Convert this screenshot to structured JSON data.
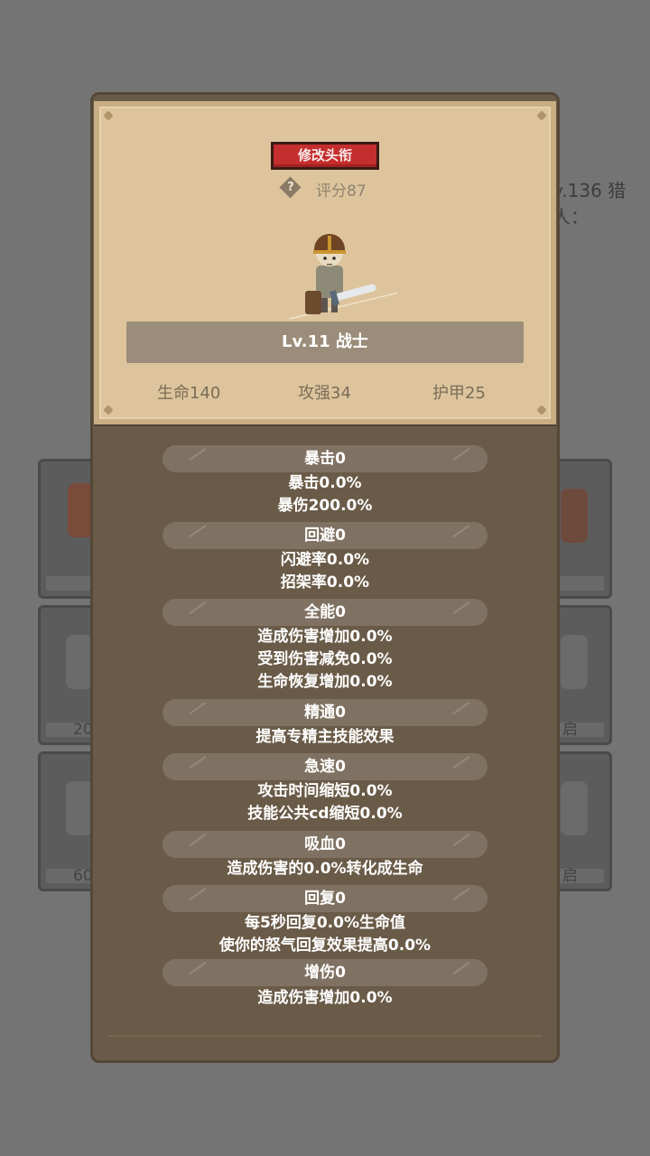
{
  "background": {
    "right_text": "v.136 猎人：",
    "card_labels": [
      "20",
      "60",
      "启",
      "启"
    ]
  },
  "panel": {
    "change_title_label": "修改头衔",
    "help_icon": "question-diamond-icon",
    "score_label": "评分87",
    "hero_name": "Lv.11 战士",
    "stats": {
      "hp": "生命140",
      "attack": "攻强34",
      "armor": "护甲25"
    }
  },
  "attributes": [
    {
      "title": "暴击0",
      "lines": [
        "暴击0.0%",
        "暴伤200.0%"
      ]
    },
    {
      "title": "回避0",
      "lines": [
        "闪避率0.0%",
        "招架率0.0%"
      ]
    },
    {
      "title": "全能0",
      "lines": [
        "造成伤害增加0.0%",
        "受到伤害减免0.0%",
        "生命恢复增加0.0%"
      ]
    },
    {
      "title": "精通0",
      "lines": [
        "提高专精主技能效果"
      ]
    },
    {
      "title": "急速0",
      "lines": [
        "攻击时间缩短0.0%",
        "技能公共cd缩短0.0%"
      ]
    },
    {
      "title": "吸血0",
      "lines": [
        "造成伤害的0.0%转化成生命"
      ]
    },
    {
      "title": "回复0",
      "lines": [
        "每5秒回复0.0%生命值",
        "使你的怒气回复效果提高0.0%"
      ]
    },
    {
      "title": "增伤0",
      "lines": [
        "造成伤害增加0.0%"
      ]
    }
  ],
  "colors": {
    "title_button": "#c52e2e",
    "parchment": "#ddc49c",
    "panel": "#6a5b48",
    "pill": "#807262"
  }
}
